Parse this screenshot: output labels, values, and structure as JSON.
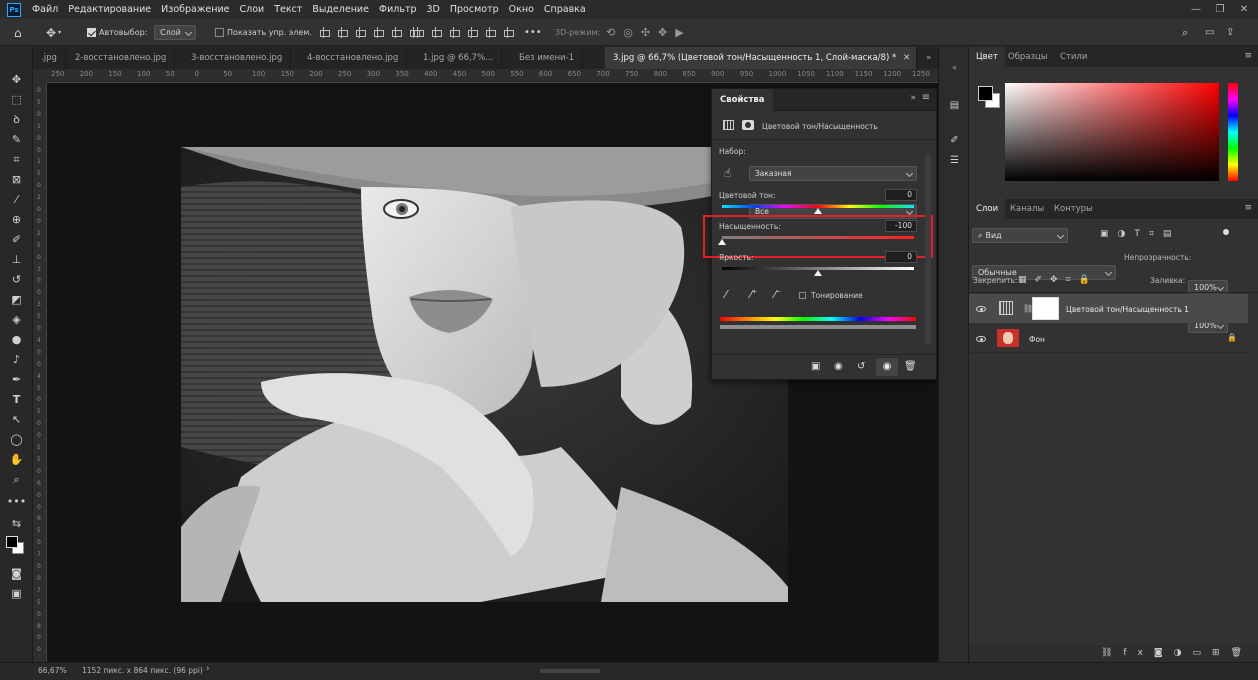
{
  "menu": {
    "logo": "Ps",
    "items": [
      "Файл",
      "Редактирование",
      "Изображение",
      "Слои",
      "Текст",
      "Выделение",
      "Фильтр",
      "3D",
      "Просмотр",
      "Окно",
      "Справка"
    ]
  },
  "options": {
    "autoselect_label": "Автовыбор:",
    "autoselect_value": "Слой",
    "show_transform_label": "Показать упр. элем.",
    "mode3d_label": "3D-режим:",
    "more": "•••"
  },
  "tabs": [
    ".jpg",
    "2-восстановлено.jpg",
    "3-восстановлено.jpg",
    "4-восстановлено.jpg",
    "1.jpg @ 66,7%...",
    "Без имени-1",
    "3.jpg @ 66,7% (Цветовой тон/Насыщенность 1, Слой-маска/8) *"
  ],
  "ruler_h": [
    "250",
    "200",
    "150",
    "100",
    "50",
    "0",
    "50",
    "100",
    "150",
    "200",
    "250",
    "300",
    "350",
    "400",
    "450",
    "500",
    "550",
    "600",
    "650",
    "700",
    "750",
    "800",
    "850",
    "900",
    "950",
    "1000",
    "1050",
    "1100",
    "1150",
    "1200",
    "1250"
  ],
  "ruler_v": [
    "0",
    "5",
    "0",
    "1",
    "0",
    "0",
    "1",
    "5",
    "0",
    "2",
    "0",
    "0",
    "2",
    "5",
    "0",
    "3",
    "0",
    "0",
    "3",
    "5",
    "0",
    "4",
    "0",
    "0",
    "4",
    "5",
    "0",
    "5",
    "0",
    "0",
    "5",
    "5",
    "0",
    "6",
    "0",
    "0",
    "6",
    "5",
    "0",
    "7",
    "0",
    "0",
    "7",
    "5",
    "0",
    "8",
    "0",
    "0"
  ],
  "props": {
    "tab": "Свойства",
    "title": "Цветовой тон/Насыщенность",
    "preset_label": "Набор:",
    "preset_value": "Заказная",
    "channel_value": "Все",
    "hue_label": "Цветовой тон:",
    "hue_value": "0",
    "sat_label": "Насыщенность:",
    "sat_value": "-100",
    "light_label": "Яркость:",
    "light_value": "0",
    "colorize_label": "Тонирование",
    "hue_pos": 0.5,
    "sat_pos": 0.0,
    "light_pos": 0.5,
    "highlight_color": "#e3202a"
  },
  "color_panel": {
    "tabs": [
      "Цвет",
      "Образцы",
      "Стили"
    ],
    "hue_color": "#ff0000"
  },
  "layers_panel": {
    "tabs": [
      "Слои",
      "Каналы",
      "Контуры"
    ],
    "filter_value": "Вид",
    "blend_value": "Обычные",
    "opacity_label": "Непрозрачность:",
    "opacity_value": "100%",
    "lock_label": "Закрепить:",
    "fill_label": "Заливка:",
    "fill_value": "100%",
    "layers": [
      {
        "name": "Цветовой тон/Насыщенность 1",
        "selected": true
      },
      {
        "name": "Фон",
        "selected": false
      }
    ]
  },
  "status": {
    "zoom": "66,67%",
    "doc_info": "1152 пикс. x 864 пикс. (96 ppi)",
    "arrow": "›"
  }
}
